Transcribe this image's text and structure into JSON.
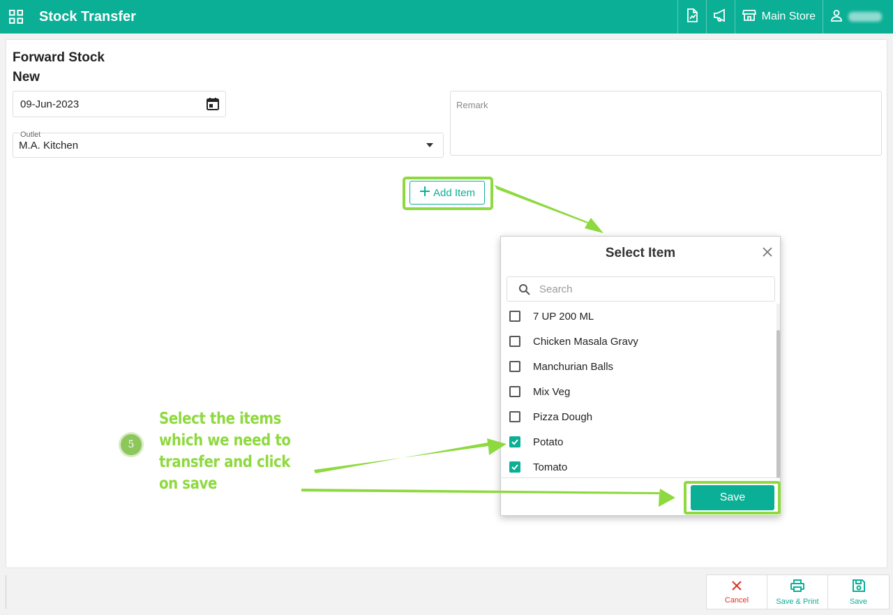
{
  "header": {
    "title": "Stock Transfer",
    "store_label": "Main Store",
    "icons": [
      "apps-grid-icon",
      "report-icon",
      "announcement-icon",
      "store-icon",
      "user-icon"
    ]
  },
  "form": {
    "heading_line1": "Forward Stock",
    "heading_line2": "New",
    "date_value": "09-Jun-2023",
    "outlet_label": "Outlet",
    "outlet_value": "M.A. Kitchen",
    "remark_placeholder": "Remark",
    "add_item_label": "Add Item"
  },
  "dialog": {
    "title": "Select Item",
    "search_placeholder": "Search",
    "items": [
      {
        "label": "7 UP 200 ML",
        "checked": false
      },
      {
        "label": "Chicken Masala Gravy",
        "checked": false
      },
      {
        "label": "Manchurian Balls",
        "checked": false
      },
      {
        "label": "Mix Veg",
        "checked": false
      },
      {
        "label": "Pizza Dough",
        "checked": false
      },
      {
        "label": "Potato",
        "checked": true
      },
      {
        "label": "Tomato",
        "checked": true
      }
    ],
    "save_label": "Save"
  },
  "annotation": {
    "step": "5",
    "line1": "Select the items",
    "line2": "which we need to",
    "line3": "transfer and click",
    "line4": "on save",
    "color": "#8ed93f"
  },
  "footer": {
    "cancel_label": "Cancel",
    "save_print_label": "Save & Print",
    "save_label": "Save"
  },
  "colors": {
    "brand": "#0aaf96",
    "danger": "#d9342b",
    "highlight": "#8ed93f"
  }
}
